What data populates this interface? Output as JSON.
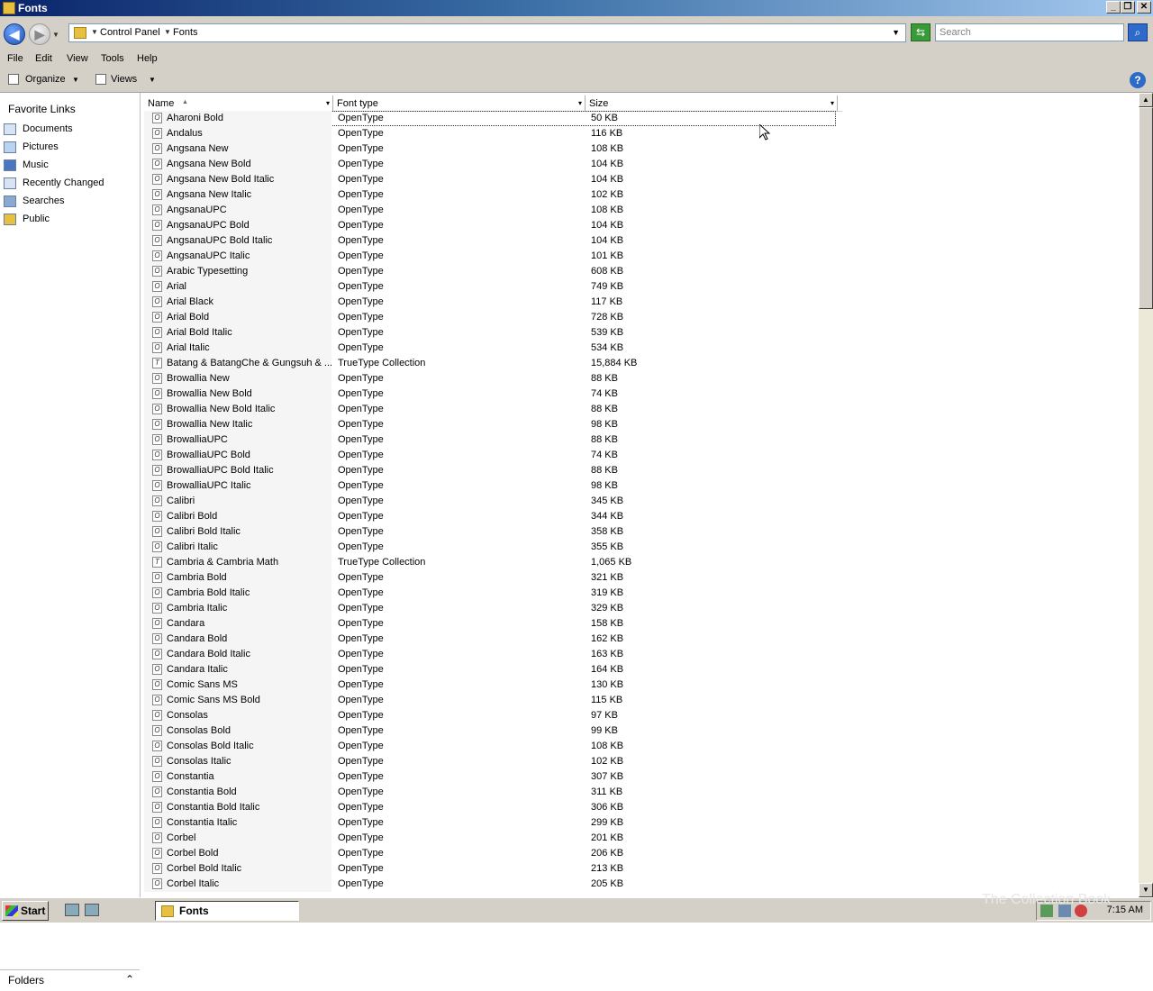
{
  "window": {
    "title": "Fonts"
  },
  "address": {
    "breadcrumbs": [
      "Control Panel",
      "Fonts"
    ],
    "search_placeholder": "Search"
  },
  "menu": [
    "File",
    "Edit",
    "View",
    "Tools",
    "Help"
  ],
  "toolbar": {
    "organize": "Organize",
    "views": "Views"
  },
  "sidebar": {
    "title": "Favorite Links",
    "links": [
      {
        "label": "Documents",
        "icon": "documents-icon",
        "color": "#d8e4f4"
      },
      {
        "label": "Pictures",
        "icon": "pictures-icon",
        "color": "#b8d4f0"
      },
      {
        "label": "Music",
        "icon": "music-icon",
        "color": "#4a78c0"
      },
      {
        "label": "Recently Changed",
        "icon": "recent-icon",
        "color": "#d8e4f4"
      },
      {
        "label": "Searches",
        "icon": "searches-icon",
        "color": "#8aa8d0"
      },
      {
        "label": "Public",
        "icon": "public-folder-icon",
        "color": "#e8c040"
      }
    ],
    "folders_label": "Folders"
  },
  "columns": {
    "name": "Name",
    "type": "Font type",
    "size": "Size"
  },
  "fonts": [
    {
      "name": "Aharoni Bold",
      "type": "OpenType",
      "size": "50 KB"
    },
    {
      "name": "Andalus",
      "type": "OpenType",
      "size": "116 KB"
    },
    {
      "name": "Angsana New",
      "type": "OpenType",
      "size": "108 KB"
    },
    {
      "name": "Angsana New Bold",
      "type": "OpenType",
      "size": "104 KB"
    },
    {
      "name": "Angsana New Bold Italic",
      "type": "OpenType",
      "size": "104 KB"
    },
    {
      "name": "Angsana New Italic",
      "type": "OpenType",
      "size": "102 KB"
    },
    {
      "name": "AngsanaUPC",
      "type": "OpenType",
      "size": "108 KB"
    },
    {
      "name": "AngsanaUPC Bold",
      "type": "OpenType",
      "size": "104 KB"
    },
    {
      "name": "AngsanaUPC Bold Italic",
      "type": "OpenType",
      "size": "104 KB"
    },
    {
      "name": "AngsanaUPC Italic",
      "type": "OpenType",
      "size": "101 KB"
    },
    {
      "name": "Arabic Typesetting",
      "type": "OpenType",
      "size": "608 KB"
    },
    {
      "name": "Arial",
      "type": "OpenType",
      "size": "749 KB"
    },
    {
      "name": "Arial Black",
      "type": "OpenType",
      "size": "117 KB"
    },
    {
      "name": "Arial Bold",
      "type": "OpenType",
      "size": "728 KB"
    },
    {
      "name": "Arial Bold Italic",
      "type": "OpenType",
      "size": "539 KB"
    },
    {
      "name": "Arial Italic",
      "type": "OpenType",
      "size": "534 KB"
    },
    {
      "name": "Batang & BatangChe & Gungsuh & ...",
      "type": "TrueType Collection",
      "size": "15,884 KB"
    },
    {
      "name": "Browallia New",
      "type": "OpenType",
      "size": "88 KB"
    },
    {
      "name": "Browallia New Bold",
      "type": "OpenType",
      "size": "74 KB"
    },
    {
      "name": "Browallia New Bold Italic",
      "type": "OpenType",
      "size": "88 KB"
    },
    {
      "name": "Browallia New Italic",
      "type": "OpenType",
      "size": "98 KB"
    },
    {
      "name": "BrowalliaUPC",
      "type": "OpenType",
      "size": "88 KB"
    },
    {
      "name": "BrowalliaUPC Bold",
      "type": "OpenType",
      "size": "74 KB"
    },
    {
      "name": "BrowalliaUPC Bold Italic",
      "type": "OpenType",
      "size": "88 KB"
    },
    {
      "name": "BrowalliaUPC Italic",
      "type": "OpenType",
      "size": "98 KB"
    },
    {
      "name": "Calibri",
      "type": "OpenType",
      "size": "345 KB"
    },
    {
      "name": "Calibri Bold",
      "type": "OpenType",
      "size": "344 KB"
    },
    {
      "name": "Calibri Bold Italic",
      "type": "OpenType",
      "size": "358 KB"
    },
    {
      "name": "Calibri Italic",
      "type": "OpenType",
      "size": "355 KB"
    },
    {
      "name": "Cambria & Cambria Math",
      "type": "TrueType Collection",
      "size": "1,065 KB"
    },
    {
      "name": "Cambria Bold",
      "type": "OpenType",
      "size": "321 KB"
    },
    {
      "name": "Cambria Bold Italic",
      "type": "OpenType",
      "size": "319 KB"
    },
    {
      "name": "Cambria Italic",
      "type": "OpenType",
      "size": "329 KB"
    },
    {
      "name": "Candara",
      "type": "OpenType",
      "size": "158 KB"
    },
    {
      "name": "Candara Bold",
      "type": "OpenType",
      "size": "162 KB"
    },
    {
      "name": "Candara Bold Italic",
      "type": "OpenType",
      "size": "163 KB"
    },
    {
      "name": "Candara Italic",
      "type": "OpenType",
      "size": "164 KB"
    },
    {
      "name": "Comic Sans MS",
      "type": "OpenType",
      "size": "130 KB"
    },
    {
      "name": "Comic Sans MS Bold",
      "type": "OpenType",
      "size": "115 KB"
    },
    {
      "name": "Consolas",
      "type": "OpenType",
      "size": "97 KB"
    },
    {
      "name": "Consolas Bold",
      "type": "OpenType",
      "size": "99 KB"
    },
    {
      "name": "Consolas Bold Italic",
      "type": "OpenType",
      "size": "108 KB"
    },
    {
      "name": "Consolas Italic",
      "type": "OpenType",
      "size": "102 KB"
    },
    {
      "name": "Constantia",
      "type": "OpenType",
      "size": "307 KB"
    },
    {
      "name": "Constantia Bold",
      "type": "OpenType",
      "size": "311 KB"
    },
    {
      "name": "Constantia Bold Italic",
      "type": "OpenType",
      "size": "306 KB"
    },
    {
      "name": "Constantia Italic",
      "type": "OpenType",
      "size": "299 KB"
    },
    {
      "name": "Corbel",
      "type": "OpenType",
      "size": "201 KB"
    },
    {
      "name": "Corbel Bold",
      "type": "OpenType",
      "size": "206 KB"
    },
    {
      "name": "Corbel Bold Italic",
      "type": "OpenType",
      "size": "213 KB"
    },
    {
      "name": "Corbel Italic",
      "type": "OpenType",
      "size": "205 KB"
    }
  ],
  "taskbar": {
    "start": "Start",
    "task": "Fonts",
    "clock": "7:15 AM"
  },
  "watermark": "The Collection Book"
}
